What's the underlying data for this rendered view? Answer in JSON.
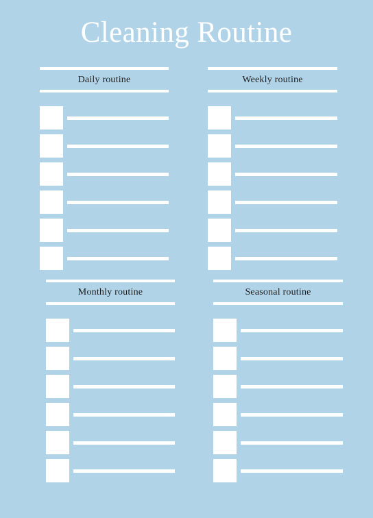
{
  "page": {
    "title": "Cleaning Routine",
    "background_color": "#b0d3e8",
    "accent_color": "#ffffff",
    "title_color": "#ffffff",
    "section_title_color": "#1d1d1d"
  },
  "sections": [
    {
      "id": "daily",
      "title": "Daily routine",
      "rows": [
        {
          "checked": false,
          "text": ""
        },
        {
          "checked": false,
          "text": ""
        },
        {
          "checked": false,
          "text": ""
        },
        {
          "checked": false,
          "text": ""
        },
        {
          "checked": false,
          "text": ""
        },
        {
          "checked": false,
          "text": ""
        }
      ]
    },
    {
      "id": "weekly",
      "title": "Weekly routine",
      "rows": [
        {
          "checked": false,
          "text": ""
        },
        {
          "checked": false,
          "text": ""
        },
        {
          "checked": false,
          "text": ""
        },
        {
          "checked": false,
          "text": ""
        },
        {
          "checked": false,
          "text": ""
        },
        {
          "checked": false,
          "text": ""
        }
      ]
    },
    {
      "id": "monthly",
      "title": "Monthly routine",
      "rows": [
        {
          "checked": false,
          "text": ""
        },
        {
          "checked": false,
          "text": ""
        },
        {
          "checked": false,
          "text": ""
        },
        {
          "checked": false,
          "text": ""
        },
        {
          "checked": false,
          "text": ""
        },
        {
          "checked": false,
          "text": ""
        }
      ]
    },
    {
      "id": "seasonal",
      "title": "Seasonal routine",
      "rows": [
        {
          "checked": false,
          "text": ""
        },
        {
          "checked": false,
          "text": ""
        },
        {
          "checked": false,
          "text": ""
        },
        {
          "checked": false,
          "text": ""
        },
        {
          "checked": false,
          "text": ""
        },
        {
          "checked": false,
          "text": ""
        }
      ]
    }
  ]
}
